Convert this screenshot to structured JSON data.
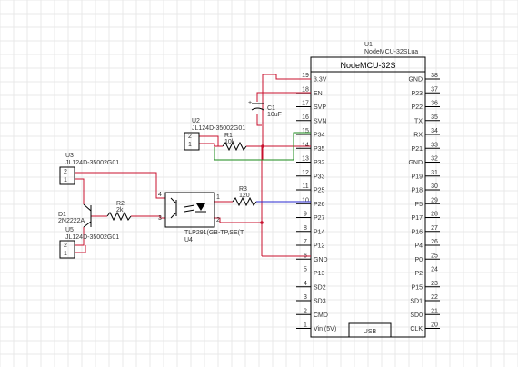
{
  "colors": {
    "wire": "#c8102e",
    "net_blue": "#2a2ad0",
    "net_green": "#1a8a1a"
  },
  "u1": {
    "ref": "U1",
    "value": "NodeMCU-32SLua",
    "title": "NodeMCU-32S",
    "usb": "USB",
    "left_pins": [
      {
        "num": "19",
        "name": "3.3V"
      },
      {
        "num": "18",
        "name": "EN"
      },
      {
        "num": "17",
        "name": "SVP"
      },
      {
        "num": "16",
        "name": "SVN"
      },
      {
        "num": "15",
        "name": "P34"
      },
      {
        "num": "14",
        "name": "P35"
      },
      {
        "num": "13",
        "name": "P32"
      },
      {
        "num": "12",
        "name": "P33"
      },
      {
        "num": "11",
        "name": "P25"
      },
      {
        "num": "10",
        "name": "P26"
      },
      {
        "num": "9",
        "name": "P27"
      },
      {
        "num": "8",
        "name": "P14"
      },
      {
        "num": "7",
        "name": "P12"
      },
      {
        "num": "6",
        "name": "GND"
      },
      {
        "num": "5",
        "name": "P13"
      },
      {
        "num": "4",
        "name": "SD2"
      },
      {
        "num": "3",
        "name": "SD3"
      },
      {
        "num": "2",
        "name": "CMD"
      },
      {
        "num": "1",
        "name": "Vin (5V)"
      }
    ],
    "right_pins": [
      {
        "num": "38",
        "name": "GND"
      },
      {
        "num": "37",
        "name": "P23"
      },
      {
        "num": "36",
        "name": "P22"
      },
      {
        "num": "35",
        "name": "TX"
      },
      {
        "num": "34",
        "name": "RX"
      },
      {
        "num": "33",
        "name": "P21"
      },
      {
        "num": "32",
        "name": "GND"
      },
      {
        "num": "31",
        "name": "P19"
      },
      {
        "num": "30",
        "name": "P18"
      },
      {
        "num": "29",
        "name": "P5"
      },
      {
        "num": "28",
        "name": "P17"
      },
      {
        "num": "27",
        "name": "P16"
      },
      {
        "num": "26",
        "name": "P4"
      },
      {
        "num": "25",
        "name": "P0"
      },
      {
        "num": "24",
        "name": "P2"
      },
      {
        "num": "23",
        "name": "P15"
      },
      {
        "num": "22",
        "name": "SD1"
      },
      {
        "num": "21",
        "name": "SD0"
      },
      {
        "num": "20",
        "name": "CLK"
      }
    ]
  },
  "c1": {
    "ref": "C1",
    "value": "10uF",
    "plus": "+"
  },
  "u2": {
    "ref": "U2",
    "value": "JL124D-35002G01",
    "pin2": "2",
    "pin1": "1"
  },
  "r1": {
    "ref": "R1",
    "value": "10k"
  },
  "u3": {
    "ref": "U3",
    "value": "JL124D-35002G01",
    "pin2": "2",
    "pin1": "1"
  },
  "d1": {
    "ref": "D1",
    "value": "2N2222A"
  },
  "u5": {
    "ref": "U5",
    "value": "JL124D-35002G01",
    "pin2": "2",
    "pin1": "1"
  },
  "r2": {
    "ref": "R2",
    "value": "2k"
  },
  "r3": {
    "ref": "R3",
    "value": "120",
    "pin1": "1",
    "pin2": "2"
  },
  "u4": {
    "ref": "U4",
    "value": "TLP291(GB-TP,SE(T",
    "pin4": "4",
    "pin3": "3",
    "pin1": "1",
    "pin2": "2"
  }
}
